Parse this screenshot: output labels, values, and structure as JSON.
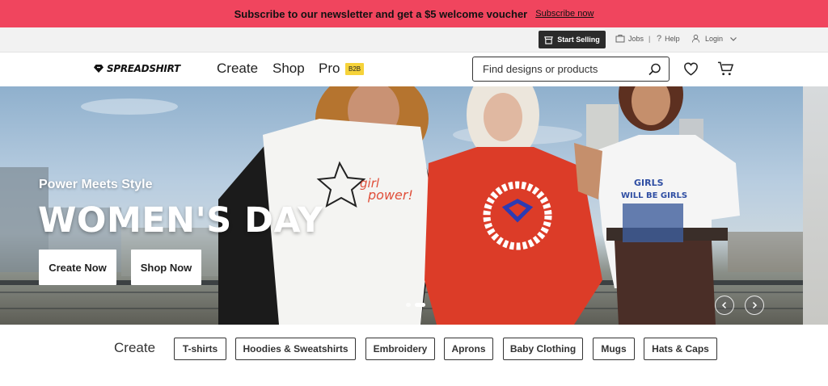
{
  "promo": {
    "text": "Subscribe to our newsletter and get a $5 welcome voucher",
    "link": "Subscribe now",
    "bg": "#f0455e"
  },
  "util": {
    "start_selling": "Start Selling",
    "jobs": "Jobs",
    "help": "Help",
    "login": "Login"
  },
  "header": {
    "logo": "SPREADSHIRT",
    "nav": [
      "Create",
      "Shop",
      "Pro"
    ],
    "badge": "B2B",
    "search_placeholder": "Find designs or products"
  },
  "hero": {
    "subtitle": "Power Meets Style",
    "title": "WOMEN'S DAY",
    "cta_primary": "Create Now",
    "cta_secondary": "Shop Now",
    "slides_total": 2,
    "slide_active": 2
  },
  "categories": {
    "label": "Create",
    "items": [
      "T-shirts",
      "Hoodies & Sweatshirts",
      "Embroidery",
      "Aprons",
      "Baby Clothing",
      "Mugs",
      "Hats & Caps"
    ]
  }
}
